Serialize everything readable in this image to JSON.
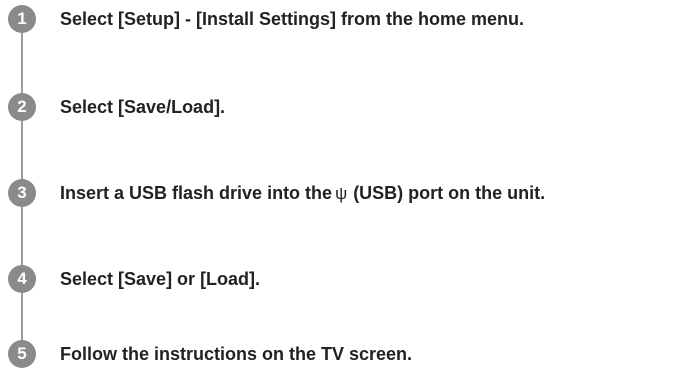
{
  "steps": [
    {
      "number": "1",
      "text": "Select [Setup] - [Install Settings] from the home menu."
    },
    {
      "number": "2",
      "text": "Select [Save/Load]."
    },
    {
      "number": "3",
      "text_before": "Insert a USB flash drive into the",
      "icon": "usb-icon",
      "icon_glyph": "ψ",
      "text_after": "(USB) port on the unit."
    },
    {
      "number": "4",
      "text": "Select [Save] or [Load]."
    },
    {
      "number": "5",
      "text": "Follow the instructions on the TV screen."
    }
  ],
  "colors": {
    "badge": "#8a8a8a",
    "rail": "#9e9e9e",
    "text": "#222222"
  }
}
